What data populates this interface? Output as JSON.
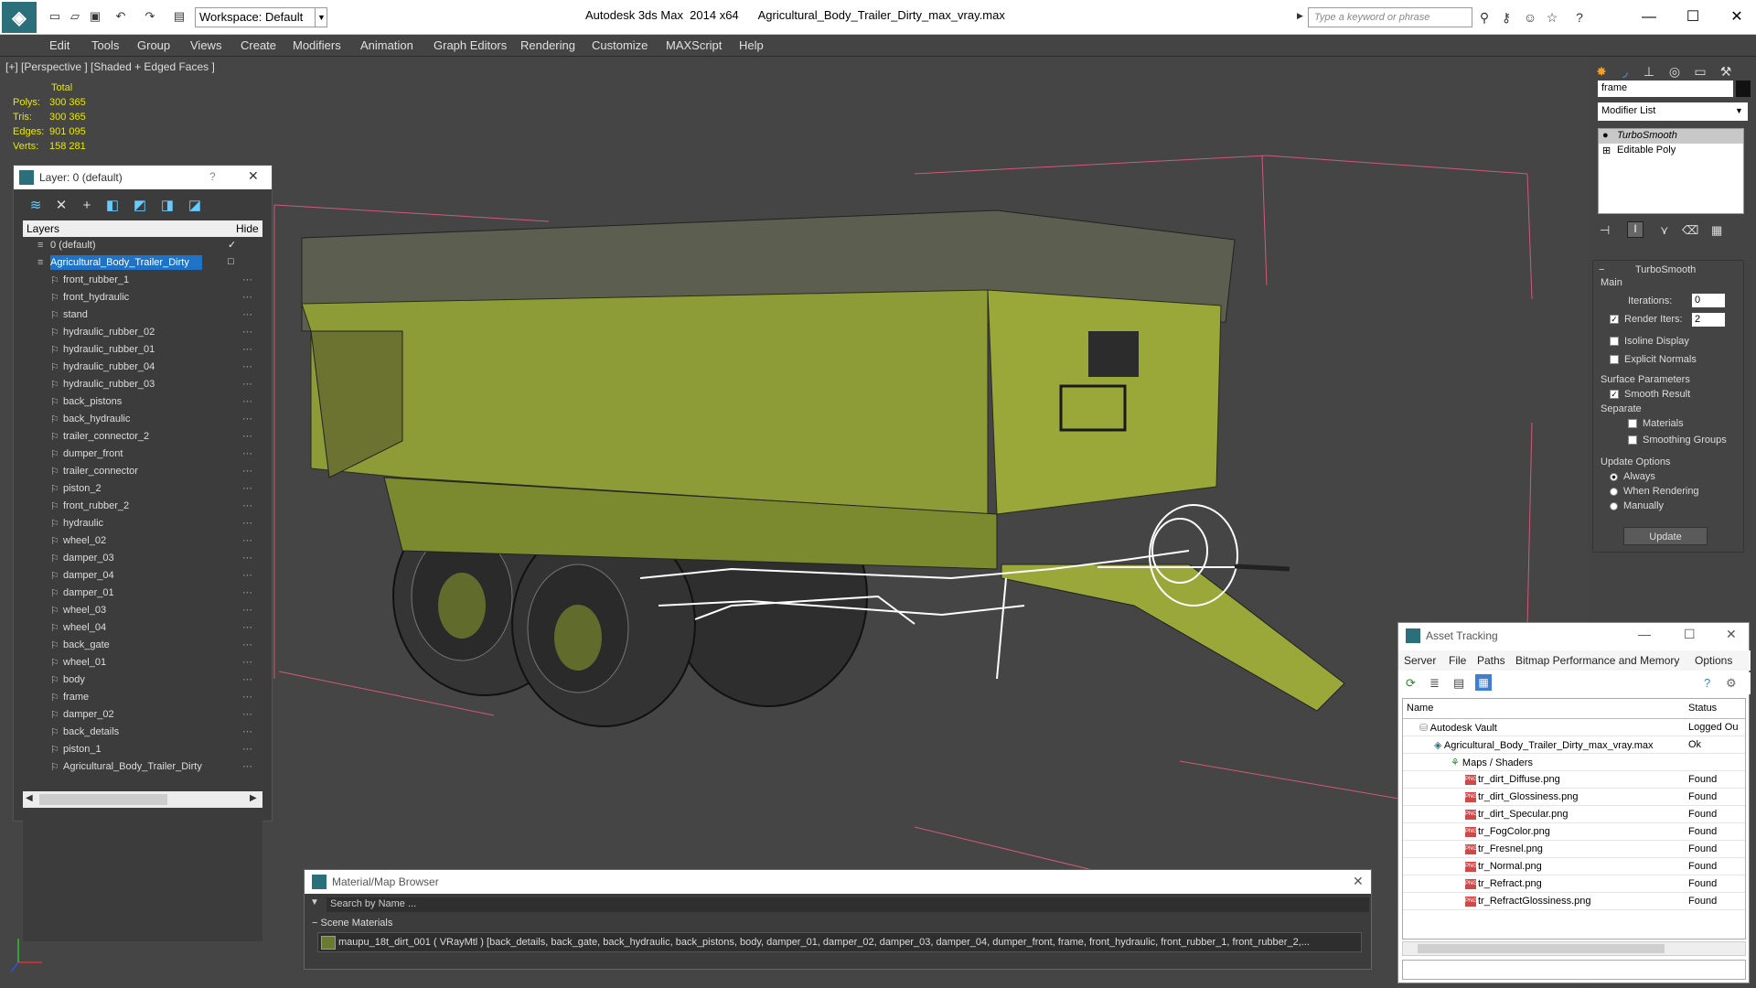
{
  "app": {
    "workspace": "Workspace: Default",
    "title": "Autodesk 3ds Max  2014 x64      Agricultural_Body_Trailer_Dirty_max_vray.max",
    "search_placeholder": "Type a keyword or phrase"
  },
  "menu": [
    "Edit",
    "Tools",
    "Group",
    "Views",
    "Create",
    "Modifiers",
    "Animation",
    "Graph Editors",
    "Rendering",
    "Customize",
    "MAXScript",
    "Help"
  ],
  "viewport": {
    "label": "[+] [Perspective ] [Shaded + Edged Faces ]",
    "stats_header": "Total",
    "stats": [
      {
        "k": "Polys:",
        "v": "300 365"
      },
      {
        "k": "Tris:",
        "v": "300 365"
      },
      {
        "k": "Edges:",
        "v": "901 095"
      },
      {
        "k": "Verts:",
        "v": "158 281"
      }
    ]
  },
  "layer_panel": {
    "title": "Layer: 0 (default)",
    "help": "?",
    "col_layers": "Layers",
    "col_hide": "Hide",
    "layers": [
      {
        "name": "0 (default)",
        "level": 0
      },
      {
        "name": "Agricultural_Body_Trailer_Dirty",
        "level": 0,
        "selected": true
      },
      {
        "name": "front_rubber_1",
        "level": 1
      },
      {
        "name": "front_hydraulic",
        "level": 1
      },
      {
        "name": "stand",
        "level": 1
      },
      {
        "name": "hydraulic_rubber_02",
        "level": 1
      },
      {
        "name": "hydraulic_rubber_01",
        "level": 1
      },
      {
        "name": "hydraulic_rubber_04",
        "level": 1
      },
      {
        "name": "hydraulic_rubber_03",
        "level": 1
      },
      {
        "name": "back_pistons",
        "level": 1
      },
      {
        "name": "back_hydraulic",
        "level": 1
      },
      {
        "name": "trailer_connector_2",
        "level": 1
      },
      {
        "name": "dumper_front",
        "level": 1
      },
      {
        "name": "trailer_connector",
        "level": 1
      },
      {
        "name": "piston_2",
        "level": 1
      },
      {
        "name": "front_rubber_2",
        "level": 1
      },
      {
        "name": "hydraulic",
        "level": 1
      },
      {
        "name": "wheel_02",
        "level": 1
      },
      {
        "name": "damper_03",
        "level": 1
      },
      {
        "name": "damper_04",
        "level": 1
      },
      {
        "name": "damper_01",
        "level": 1
      },
      {
        "name": "wheel_03",
        "level": 1
      },
      {
        "name": "wheel_04",
        "level": 1
      },
      {
        "name": "back_gate",
        "level": 1
      },
      {
        "name": "wheel_01",
        "level": 1
      },
      {
        "name": "body",
        "level": 1
      },
      {
        "name": "frame",
        "level": 1
      },
      {
        "name": "damper_02",
        "level": 1
      },
      {
        "name": "back_details",
        "level": 1
      },
      {
        "name": "piston_1",
        "level": 1
      },
      {
        "name": "Agricultural_Body_Trailer_Dirty",
        "level": 1
      }
    ]
  },
  "command_panel": {
    "object_name": "frame",
    "modifier_list": "Modifier List",
    "stack": [
      {
        "name": "TurboSmooth",
        "selected": true
      },
      {
        "name": "Editable Poly",
        "selected": false
      }
    ],
    "rollout_title": "TurboSmooth",
    "main_label": "Main",
    "iterations_label": "Iterations:",
    "iterations": "0",
    "render_iters_label": "Render Iters:",
    "render_iters": "2",
    "isoline": "Isoline Display",
    "explicit_normals": "Explicit Normals",
    "surface_params": "Surface Parameters",
    "smooth_result": "Smooth Result",
    "separate": "Separate",
    "materials": "Materials",
    "smoothing_groups": "Smoothing Groups",
    "update_options": "Update Options",
    "always": "Always",
    "when_rendering": "When Rendering",
    "manually": "Manually",
    "update_button": "Update"
  },
  "asset_tracking": {
    "title": "Asset Tracking",
    "menu": [
      "Server",
      "File",
      "Paths",
      "Bitmap Performance and Memory",
      "Options"
    ],
    "col_name": "Name",
    "col_status": "Status",
    "rows": [
      {
        "name": "Autodesk Vault",
        "status": "Logged Ou",
        "indent": 18,
        "icon": "vault"
      },
      {
        "name": "Agricultural_Body_Trailer_Dirty_max_vray.max",
        "status": "Ok",
        "indent": 34,
        "icon": "max"
      },
      {
        "name": "Maps / Shaders",
        "status": "",
        "indent": 52,
        "icon": "maps"
      },
      {
        "name": "tr_dirt_Diffuse.png",
        "status": "Found",
        "indent": 68,
        "icon": "png"
      },
      {
        "name": "tr_dirt_Glossiness.png",
        "status": "Found",
        "indent": 68,
        "icon": "png"
      },
      {
        "name": "tr_dirt_Specular.png",
        "status": "Found",
        "indent": 68,
        "icon": "png"
      },
      {
        "name": "tr_FogColor.png",
        "status": "Found",
        "indent": 68,
        "icon": "png"
      },
      {
        "name": "tr_Fresnel.png",
        "status": "Found",
        "indent": 68,
        "icon": "png"
      },
      {
        "name": "tr_Normal.png",
        "status": "Found",
        "indent": 68,
        "icon": "png"
      },
      {
        "name": "tr_Refract.png",
        "status": "Found",
        "indent": 68,
        "icon": "png"
      },
      {
        "name": "tr_RefractGlossiness.png",
        "status": "Found",
        "indent": 68,
        "icon": "png"
      }
    ]
  },
  "material_browser": {
    "title": "Material/Map Browser",
    "search_placeholder": "Search by Name ...",
    "section": "Scene Materials",
    "item": "maupu_18t_dirt_001  ( VRayMtl )  [back_details, back_gate, back_hydraulic, back_pistons, body, damper_01, damper_02, damper_03, damper_04, dumper_front, frame, front_hydraulic, front_rubber_1, front_rubber_2,..."
  },
  "colors": {
    "trailer_green": "#9aa83a",
    "stats_yellow": "#e8e800",
    "selection_blue": "#1e73c8",
    "viewport_bg": "#454545"
  }
}
